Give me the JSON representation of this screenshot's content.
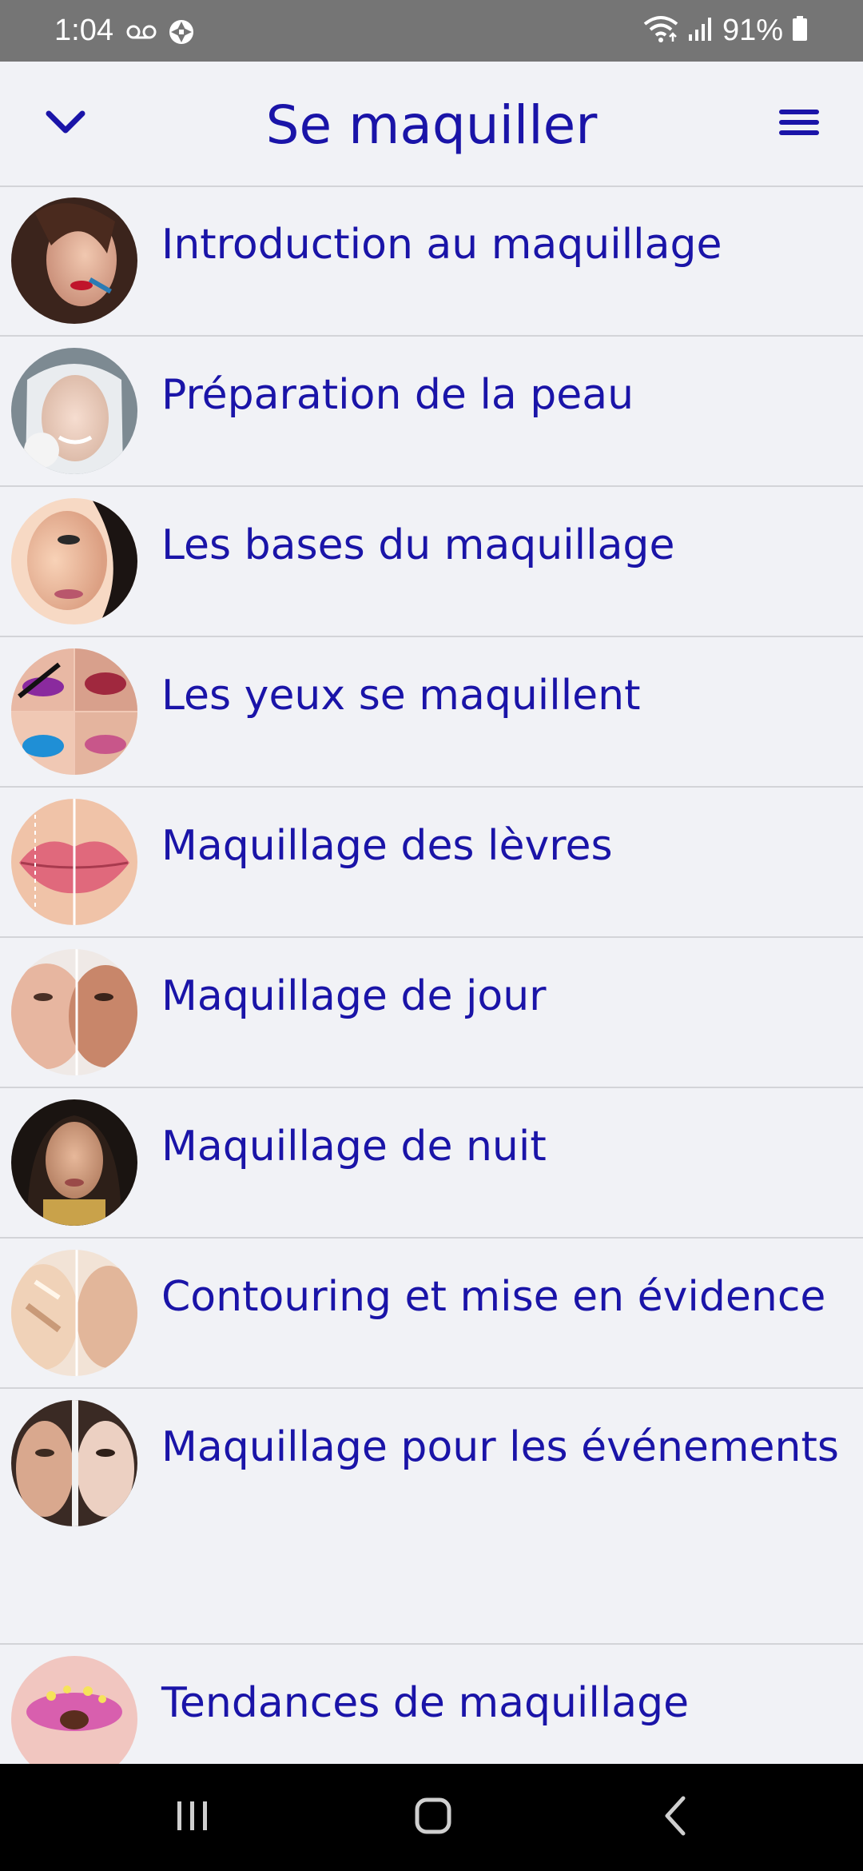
{
  "status_bar": {
    "time": "1:04",
    "battery": "91%",
    "icons": [
      "voicemail-icon",
      "camera-shutter-icon",
      "wifi-icon",
      "signal-icon",
      "battery-icon"
    ]
  },
  "header": {
    "title": "Se maquiller",
    "back_icon": "chevron-down-icon",
    "menu_icon": "hamburger-menu-icon"
  },
  "colors": {
    "accent": "#1a14a8",
    "background": "#f1f2f6",
    "divider": "#d3d4d8",
    "status_bar": "#757575",
    "nav_bar": "#000000"
  },
  "list": {
    "items": [
      {
        "label": "Introduction au maquillage"
      },
      {
        "label": "Préparation de la peau"
      },
      {
        "label": "Les bases du maquillage"
      },
      {
        "label": "Les yeux se maquillent"
      },
      {
        "label": "Maquillage des lèvres"
      },
      {
        "label": "Maquillage de jour"
      },
      {
        "label": "Maquillage de nuit"
      },
      {
        "label": "Contouring et mise en évidence"
      },
      {
        "label": "Maquillage pour les événements"
      },
      {
        "label": "Tendances de maquillage"
      }
    ]
  },
  "nav_bar": {
    "icons": [
      "recent-apps-icon",
      "home-icon",
      "back-icon"
    ]
  }
}
